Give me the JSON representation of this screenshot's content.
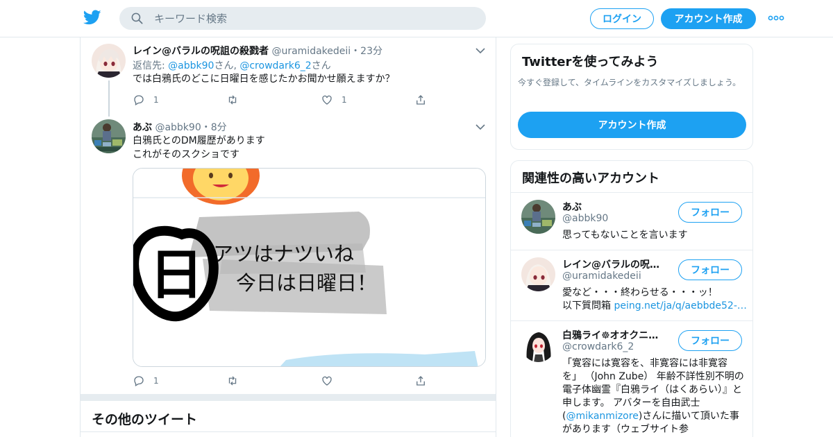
{
  "colors": {
    "accent": "#1da1f2",
    "link": "#1b95e0",
    "muted": "#657786",
    "border": "#e1e8ed"
  },
  "topbar": {
    "logo_icon": "twitter-bird-icon",
    "search_placeholder": "キーワード検索",
    "login_label": "ログイン",
    "signup_label": "アカウント作成",
    "more_icon": "more-dots-icon"
  },
  "tweets": [
    {
      "name": "レイン@バラルの呪詛の殺戮者",
      "handle": "@uramidakedeii",
      "time": "・23分",
      "reply_prefix": "返信先: ",
      "reply_user1": "@abbk90",
      "reply_sep": "さん, ",
      "reply_user2": "@crowdark6_2",
      "reply_suffix": "さん",
      "text": "では白鴉氏のどこに日曜日を感じたかお聞かせ願えますか？",
      "reply_count": "1",
      "retweet_count": "",
      "like_count": "1"
    },
    {
      "name": "あぶ",
      "handle": "@abbk90",
      "time": "・8分",
      "text_line1": "白鴉氏とのDM履歴があります",
      "text_line2": "これがそのスクショです",
      "media_line1": "アツはナツいね",
      "media_line2": "今日は日曜日！",
      "media_stamp": "日",
      "reply_count": "1",
      "retweet_count": "",
      "like_count": ""
    }
  ],
  "other_tweets_title": "その他のツイート",
  "sidebar": {
    "try_title": "Twitterを使ってみよう",
    "try_desc": "今すぐ登録して、タイムラインをカスタマイズしましょう。",
    "try_button": "アカウント作成",
    "related_title": "関連性の高いアカウント",
    "follow_label": "フォロー",
    "accounts": [
      {
        "name": "あぶ",
        "handle": "@abbk90",
        "bio": "思ってもないことを言います"
      },
      {
        "name": "レイン@バラルの呪…",
        "handle": "@uramidakedeii",
        "bio_line1": "愛など・・・終わらせる・・・ッ！",
        "bio_prefix": "以下質問箱 ",
        "bio_link": "peing.net/ja/q/aebbde52-…"
      },
      {
        "name": "白鴉ライ☸オオクニ…",
        "handle": "@crowdark6_2",
        "bio_part1": "「寛容には寛容を、非寛容には非寛容を」 （John Zube） 年齢不詳性別不明の電子体幽霊『白鴉ライ（はくあらい）』と申します。 アバターを自由武士(",
        "bio_link": "@mikanmizore",
        "bio_part2": ")さんに描いて頂いた事があります（ウェブサイト参"
      }
    ]
  }
}
